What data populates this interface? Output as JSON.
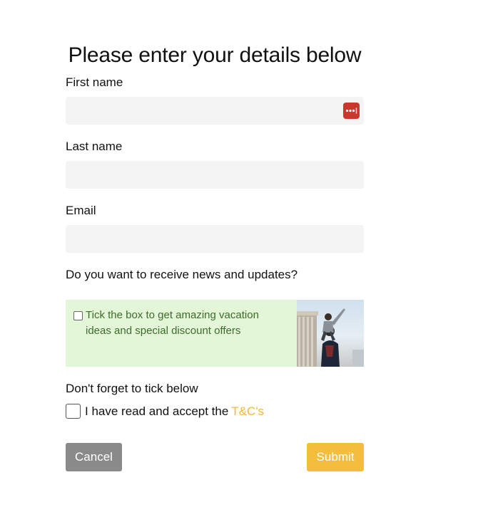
{
  "page": {
    "title": "Please enter your details below"
  },
  "fields": {
    "first_name": {
      "label": "First name",
      "value": "",
      "placeholder": ""
    },
    "last_name": {
      "label": "Last name",
      "value": "",
      "placeholder": ""
    },
    "email": {
      "label": "Email",
      "value": "",
      "placeholder": ""
    }
  },
  "newsletter": {
    "question": "Do you want to receive news and updates?",
    "checkbox_label": "Tick the box to get amazing vacation ideas and special discount offers",
    "checked": false
  },
  "terms": {
    "reminder": "Don't forget to tick below",
    "accept_text": "I have read and accept the",
    "link_text": "T&C's",
    "checked": false
  },
  "buttons": {
    "cancel": "Cancel",
    "submit": "Submit"
  },
  "icons": {
    "password_manager": "password-manager-icon"
  },
  "colors": {
    "accent": "#f4bd3c",
    "link": "#f3b739",
    "cancel": "#8a8a8a",
    "promo_bg": "#e3f7d8",
    "promo_text": "#3d6b2a",
    "password_icon": "#c9382c"
  }
}
